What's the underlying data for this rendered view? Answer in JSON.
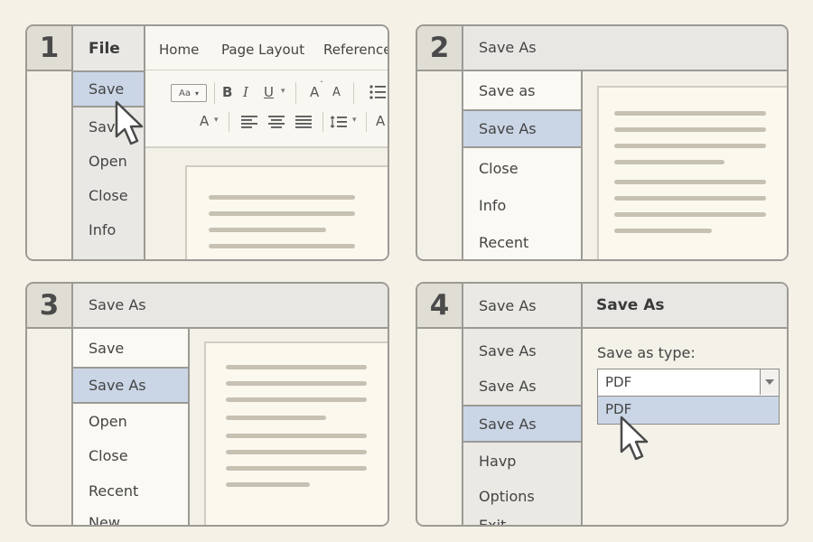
{
  "steps": [
    "1",
    "2",
    "3",
    "4"
  ],
  "step1": {
    "file_label": "File",
    "tabs": [
      "Home",
      "Page Layout",
      "Reference"
    ],
    "menu": [
      "Save",
      "Save",
      "Open",
      "Close",
      "Info"
    ],
    "font_box": "Aa",
    "toolbar_row1": [
      "B",
      "I",
      "U",
      "A",
      "A"
    ],
    "toolbar_row2": [
      "A",
      "A"
    ]
  },
  "step2": {
    "title": "Save As",
    "menu": [
      "Save as",
      "Save As",
      "Close",
      "Info",
      "Recent"
    ]
  },
  "step3": {
    "title": "Save As",
    "menu": [
      "Save",
      "Save As",
      "Open",
      "Close",
      "Recent",
      "New"
    ]
  },
  "step4": {
    "menu": [
      "Save As",
      "Save As",
      "Save As",
      "Save As",
      "Havp",
      "Options",
      "Exit"
    ],
    "dialog_title": "Save As",
    "type_label": "Save as type:",
    "type_value": "PDF",
    "dropdown_option": "PDF"
  },
  "colors": {
    "selected": "#cad6e6",
    "border": "#9c9a95",
    "page": "#fbf8ee"
  }
}
